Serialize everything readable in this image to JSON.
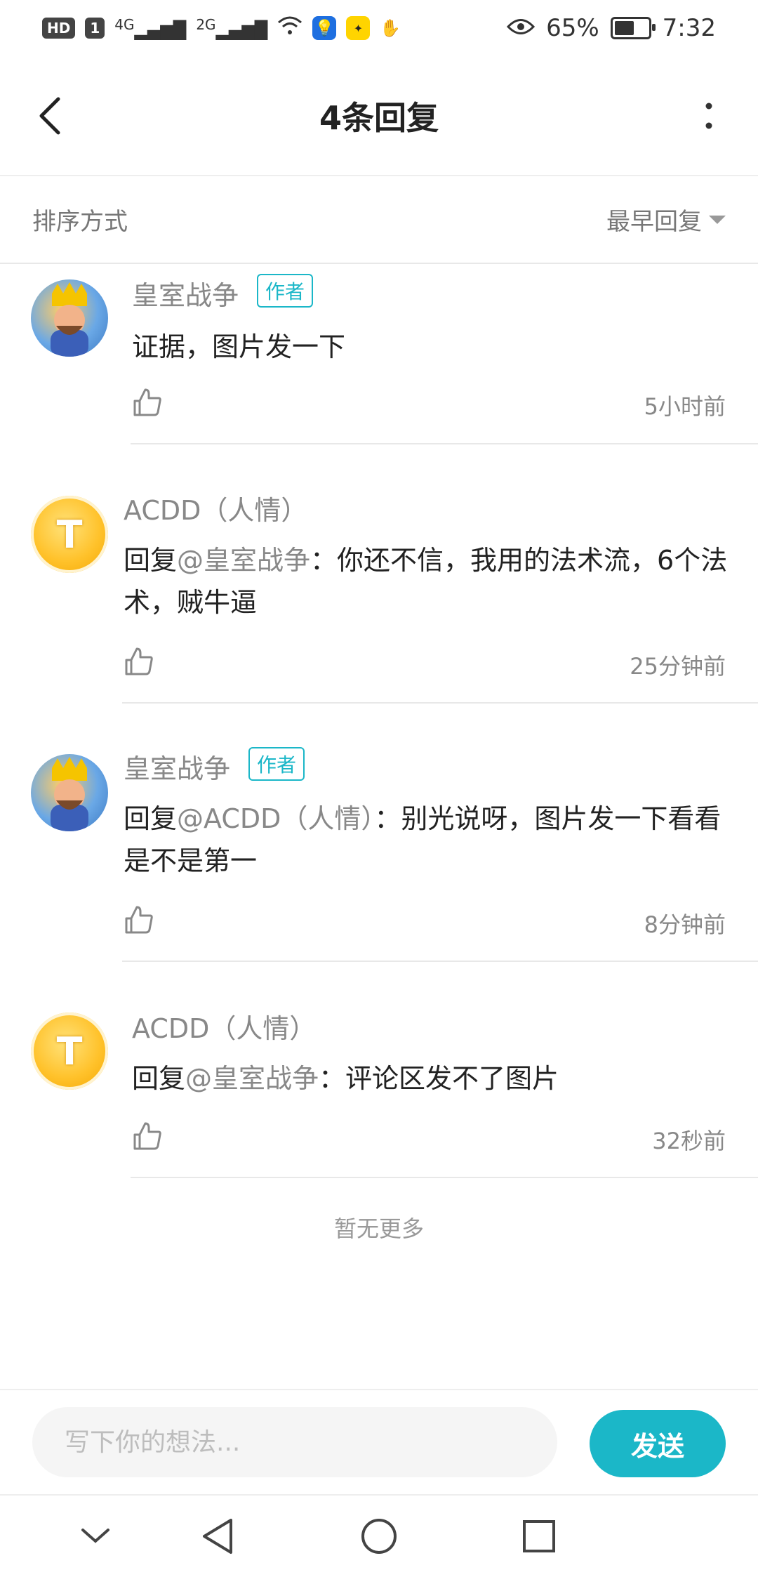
{
  "status_bar": {
    "hd": "HD",
    "sim": "1",
    "signal1": "4G",
    "signal2": "2G",
    "battery": "65%",
    "battery_level": 0.65,
    "time": "7:32"
  },
  "header": {
    "title": "4条回复"
  },
  "sort": {
    "label": "排序方式",
    "value": "最早回复"
  },
  "comments": [
    {
      "name": "皇室战争",
      "tag": "作者",
      "content": "证据，图片发一下",
      "time": "5小时前"
    },
    {
      "name": "ACDD（人情）",
      "reply_prefix": "回复",
      "reply_to": "@皇室战争",
      "content": "：你还不信，我用的法术流，6个法术，贼牛逼",
      "time": "25分钟前"
    },
    {
      "name": "皇室战争",
      "tag": "作者",
      "reply_prefix": "回复",
      "reply_to": "@ACDD（人情）",
      "content": "：别光说呀，图片发一下看看是不是第一",
      "time": "8分钟前"
    },
    {
      "name": "ACDD（人情）",
      "reply_prefix": "回复",
      "reply_to": "@皇室战争",
      "content": "：评论区发不了图片",
      "time": "32秒前"
    }
  ],
  "footer_note": "暂无更多",
  "input": {
    "placeholder": "写下你的想法...",
    "send": "发送"
  },
  "colors": {
    "accent": "#1bb7c8"
  }
}
